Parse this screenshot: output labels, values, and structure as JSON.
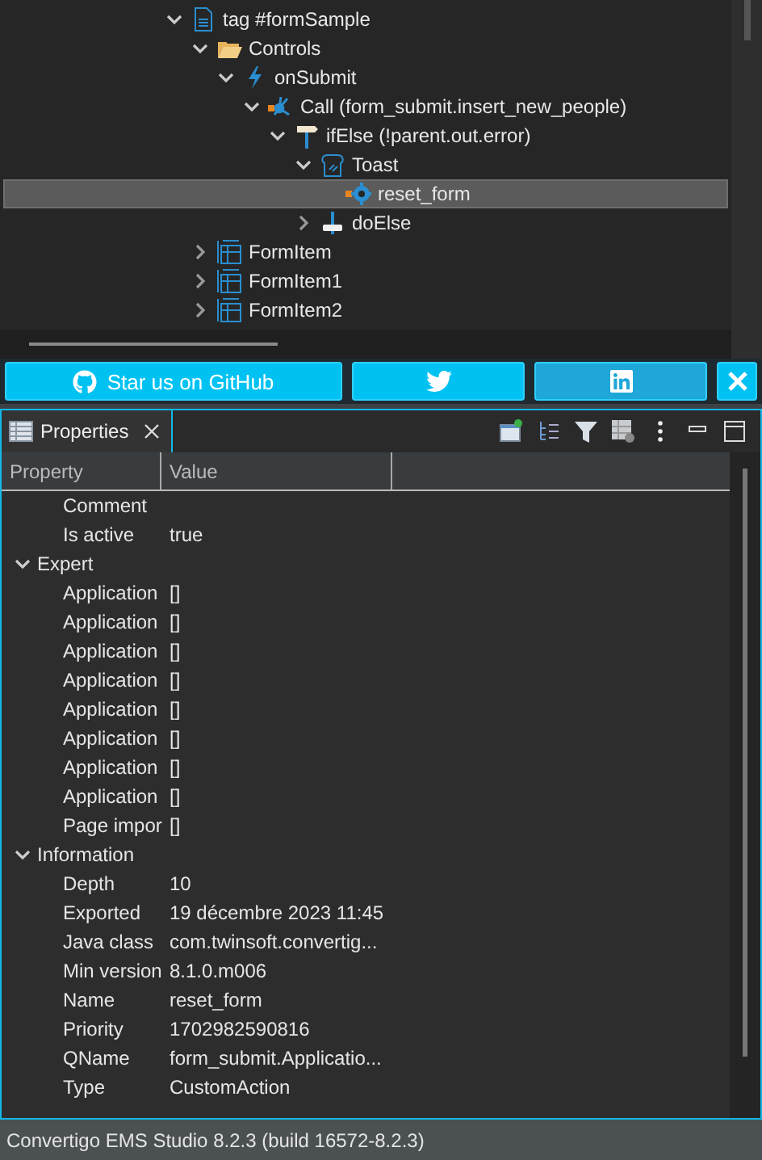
{
  "tree": {
    "nodes": [
      {
        "label": "tag #formSample",
        "kind": "page",
        "expandable": true,
        "expanded": true,
        "selected": false,
        "children": [
          {
            "label": "Controls",
            "kind": "folder",
            "expandable": true,
            "expanded": true,
            "selected": false,
            "children": [
              {
                "label": "onSubmit",
                "kind": "event",
                "expandable": true,
                "expanded": true,
                "selected": false,
                "children": [
                  {
                    "label": "Call (form_submit.insert_new_people)",
                    "kind": "call",
                    "expandable": true,
                    "expanded": true,
                    "selected": false,
                    "children": [
                      {
                        "label": "ifElse (!parent.out.error)",
                        "kind": "ifelse",
                        "expandable": true,
                        "expanded": true,
                        "selected": false,
                        "children": [
                          {
                            "label": "Toast",
                            "kind": "toast",
                            "expandable": true,
                            "expanded": true,
                            "selected": false,
                            "children": [
                              {
                                "label": "reset_form",
                                "kind": "action",
                                "expandable": false,
                                "selected": true
                              }
                            ]
                          },
                          {
                            "label": "doElse",
                            "kind": "doelse",
                            "expandable": true,
                            "expanded": false,
                            "selected": false
                          }
                        ]
                      }
                    ]
                  }
                ]
              }
            ]
          },
          {
            "label": "FormItem",
            "kind": "formitem",
            "expandable": true,
            "expanded": false,
            "selected": false
          },
          {
            "label": "FormItem1",
            "kind": "formitem",
            "expandable": true,
            "expanded": false,
            "selected": false
          },
          {
            "label": "FormItem2",
            "kind": "formitem",
            "expandable": true,
            "expanded": false,
            "selected": false
          }
        ]
      }
    ]
  },
  "social_bar": {
    "buttons": [
      {
        "kind": "github",
        "label": "Star us on GitHub"
      },
      {
        "kind": "twitter"
      },
      {
        "kind": "linkedin"
      },
      {
        "kind": "close"
      }
    ]
  },
  "properties_view": {
    "tab": {
      "title": "Properties",
      "selected": true
    },
    "toolbar": [
      {
        "kind": "pin"
      },
      {
        "kind": "tree"
      },
      {
        "kind": "filter"
      },
      {
        "kind": "table"
      },
      {
        "kind": "more"
      },
      {
        "kind": "minimize"
      },
      {
        "kind": "maximize"
      }
    ],
    "columns": [
      "Property",
      "Value"
    ],
    "rows": [
      {
        "kind": "property",
        "name": "Comment"
      },
      {
        "kind": "property",
        "name": "Is active",
        "value": "true"
      },
      {
        "kind": "category",
        "name": "Expert",
        "expanded": true
      },
      {
        "kind": "property",
        "name": "Application",
        "value": "[]"
      },
      {
        "kind": "property",
        "name": "Application",
        "value": "[]"
      },
      {
        "kind": "property",
        "name": "Application",
        "value": "[]"
      },
      {
        "kind": "property",
        "name": "Application",
        "value": "[]"
      },
      {
        "kind": "property",
        "name": "Application",
        "value": "[]"
      },
      {
        "kind": "property",
        "name": "Application",
        "value": "[]"
      },
      {
        "kind": "property",
        "name": "Application",
        "value": "[]"
      },
      {
        "kind": "property",
        "name": "Application",
        "value": "[]"
      },
      {
        "kind": "property",
        "name": "Page impor",
        "value": "[]"
      },
      {
        "kind": "category",
        "name": "Information",
        "expanded": true
      },
      {
        "kind": "property",
        "name": "Depth",
        "value": "10"
      },
      {
        "kind": "property",
        "name": "Exported",
        "value": "19 décembre 2023 11:45"
      },
      {
        "kind": "property",
        "name": "Java class",
        "value": "com.twinsoft.convertig..."
      },
      {
        "kind": "property",
        "name": "Min version",
        "value": "8.1.0.m006"
      },
      {
        "kind": "property",
        "name": "Name",
        "value": "reset_form"
      },
      {
        "kind": "property",
        "name": "Priority",
        "value": "1702982590816"
      },
      {
        "kind": "property",
        "name": "QName",
        "value": "form_submit.Applicatio..."
      },
      {
        "kind": "property",
        "name": "Type",
        "value": "CustomAction"
      }
    ]
  },
  "status_bar": {
    "text": "Convertigo EMS Studio 8.2.3 (build 16572-8.2.3)"
  }
}
